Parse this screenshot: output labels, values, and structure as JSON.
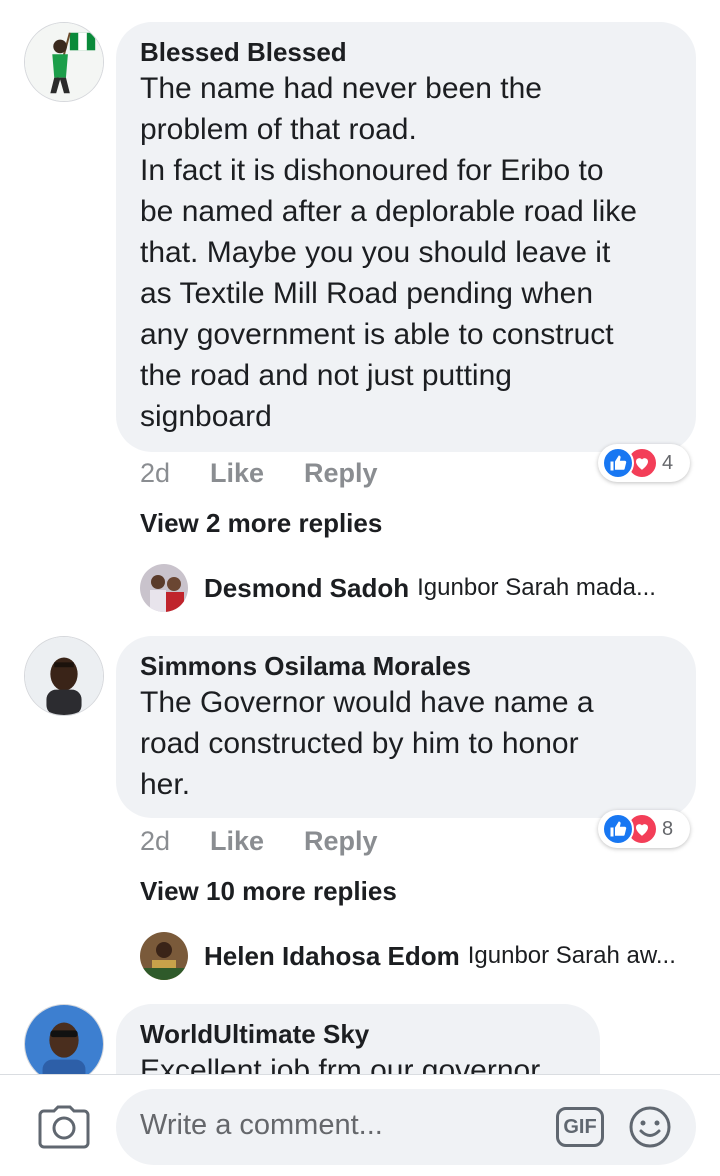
{
  "comments": [
    {
      "author": "Blessed Blessed",
      "text": "The name had never been the\nproblem of that road.\nIn fact it is dishonoured for Eribo to\nbe named after a deplorable road like\nthat. Maybe you you should leave it\nas Textile Mill Road pending when\nany government is able to construct\nthe road and not just putting\nsignboard",
      "time": "2d",
      "like_label": "Like",
      "reply_label": "Reply",
      "reaction_count": "4",
      "view_more": "View 2 more replies",
      "latest_reply": {
        "author": "Desmond Sadoh",
        "snippet": "Igunbor Sarah mada..."
      }
    },
    {
      "author": "Simmons Osilama Morales",
      "text": "The Governor would have name a\nroad constructed by him to honor\nher.",
      "time": "2d",
      "like_label": "Like",
      "reply_label": "Reply",
      "reaction_count": "8",
      "view_more": "View 10 more replies",
      "latest_reply": {
        "author": "Helen Idahosa Edom",
        "snippet": "Igunbor Sarah aw..."
      }
    },
    {
      "author": "WorldUltimate Sky",
      "text": "Excellent job frm our governor"
    }
  ],
  "composer": {
    "placeholder": "Write a comment...",
    "gif_label": "GIF"
  },
  "icons": {
    "like": "like-icon",
    "love": "love-icon",
    "camera": "camera-icon",
    "emoji": "emoji-icon"
  },
  "colors": {
    "like_blue": "#1877f2",
    "love_red": "#f33e58",
    "bubble_bg": "#f0f2f5"
  }
}
